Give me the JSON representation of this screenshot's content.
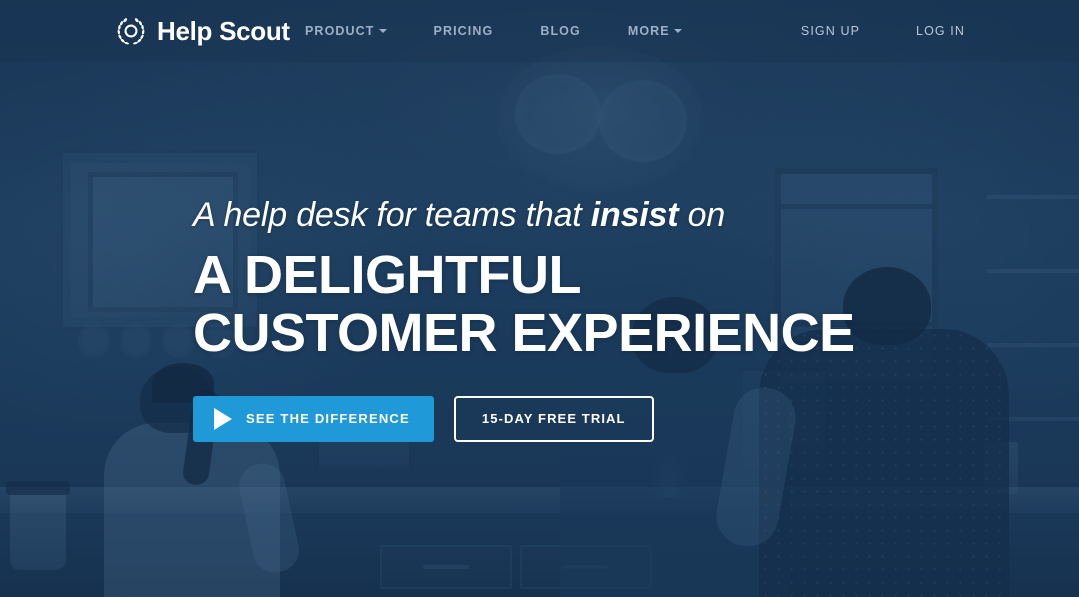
{
  "header": {
    "brand": {
      "name": "Help Scout",
      "icon": "laurel-wreath-icon"
    },
    "nav": [
      {
        "label": "PRODUCT",
        "has_dropdown": true
      },
      {
        "label": "PRICING",
        "has_dropdown": false
      },
      {
        "label": "BLOG",
        "has_dropdown": false
      },
      {
        "label": "MORE",
        "has_dropdown": true
      }
    ],
    "auth": [
      {
        "label": "SIGN UP"
      },
      {
        "label": "LOG IN"
      }
    ]
  },
  "hero": {
    "kicker_before": "A help desk for teams that ",
    "kicker_emphasis": "insist",
    "kicker_after": " on",
    "title_line1": "A DELIGHTFUL",
    "title_line2": "CUSTOMER EXPERIENCE",
    "primary_cta": {
      "label": "SEE THE DIFFERENCE",
      "icon": "play-icon"
    },
    "secondary_cta": {
      "label": "15-DAY FREE TRIAL"
    }
  },
  "colors": {
    "accent_blue": "#2099d8",
    "overlay_blue": "#2b5074",
    "header_overlay": "#16325021",
    "nav_text": "#9db0c6",
    "auth_text": "#b9c7d8",
    "text_white": "#ffffff"
  }
}
